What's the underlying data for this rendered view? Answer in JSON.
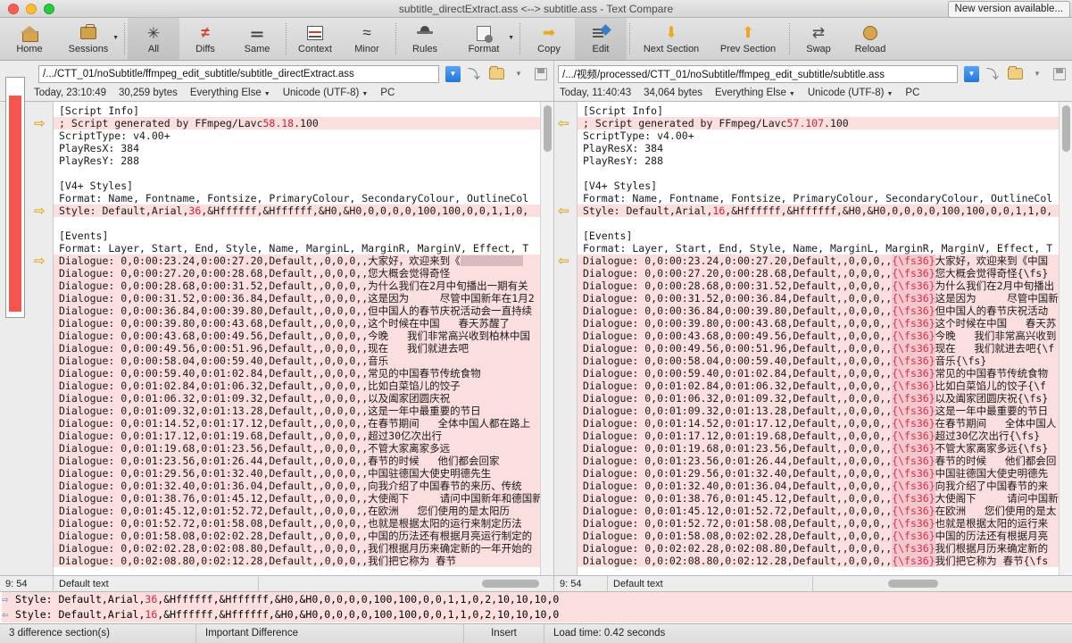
{
  "window": {
    "title": "subtitle_directExtract.ass <--> subtitle.ass - Text Compare",
    "new_version_button": "New version available..."
  },
  "toolbar": {
    "buttons": [
      {
        "label": "Home",
        "icon": "home-icon",
        "active": false,
        "dropdown": false
      },
      {
        "label": "Sessions",
        "icon": "briefcase-icon",
        "active": false,
        "dropdown": true
      },
      {
        "label": "All",
        "icon": "asterisk-icon",
        "active": true,
        "dropdown": false
      },
      {
        "label": "Diffs",
        "icon": "not-equal-icon",
        "active": false,
        "dropdown": false
      },
      {
        "label": "Same",
        "icon": "equals-icon",
        "active": false,
        "dropdown": false
      },
      {
        "label": "Context",
        "icon": "context-lines-icon",
        "active": false,
        "dropdown": false
      },
      {
        "label": "Minor",
        "icon": "approx-equal-icon",
        "active": false,
        "dropdown": false
      },
      {
        "label": "Rules",
        "icon": "rules-detective-icon",
        "active": false,
        "dropdown": false
      },
      {
        "label": "Format",
        "icon": "format-gear-icon",
        "active": false,
        "dropdown": true
      },
      {
        "label": "Copy",
        "icon": "copy-arrow-icon",
        "active": false,
        "dropdown": false
      },
      {
        "label": "Edit",
        "icon": "edit-pencil-icon",
        "active": true,
        "dropdown": false
      },
      {
        "label": "Next Section",
        "icon": "arrow-down-icon",
        "active": false,
        "dropdown": false
      },
      {
        "label": "Prev Section",
        "icon": "arrow-up-icon",
        "active": false,
        "dropdown": false
      },
      {
        "label": "Swap",
        "icon": "swap-icon",
        "active": false,
        "dropdown": false
      },
      {
        "label": "Reload",
        "icon": "reload-icon",
        "active": false,
        "dropdown": false
      }
    ]
  },
  "left_file": {
    "path": "/.../CTT_01/noSubtitle/ffmpeg_edit_subtitle/subtitle_directExtract.ass",
    "timestamp": "Today, 23:10:49",
    "size": "30,259 bytes",
    "ruleset": "Everything Else",
    "encoding": "Unicode (UTF-8)",
    "line_endings": "PC",
    "cursor": "9: 54",
    "style_info": "Default text"
  },
  "right_file": {
    "path": "/.../视频/processed/CTT_01/noSubtitle/ffmpeg_edit_subtitle/subtitle.ass",
    "timestamp": "Today, 11:40:43",
    "size": "34,064 bytes",
    "ruleset": "Everything Else",
    "encoding": "Unicode (UTF-8)",
    "line_endings": "PC",
    "cursor": "9: 54",
    "style_info": "Default text"
  },
  "left_lines": [
    {
      "text": "[Script Info]",
      "diff": false,
      "marker": false
    },
    {
      "text": "; Script generated by FFmpeg/Lavc58.18.100",
      "diff": true,
      "marker": true,
      "hl": "58.18"
    },
    {
      "text": "ScriptType: v4.00+",
      "diff": false,
      "marker": false
    },
    {
      "text": "PlayResX: 384",
      "diff": false,
      "marker": false
    },
    {
      "text": "PlayResY: 288",
      "diff": false,
      "marker": false
    },
    {
      "text": "",
      "diff": false,
      "marker": false
    },
    {
      "text": "[V4+ Styles]",
      "diff": false,
      "marker": false
    },
    {
      "text": "Format: Name, Fontname, Fontsize, PrimaryColour, SecondaryColour, OutlineCol",
      "diff": false,
      "marker": false
    },
    {
      "text": "Style: Default,Arial,36,&Hffffff,&Hffffff,&H0,&H0,0,0,0,0,100,100,0,0,1,1,0,",
      "diff": true,
      "marker": true,
      "hl": "36"
    },
    {
      "text": "",
      "diff": false,
      "marker": false
    },
    {
      "text": "[Events]",
      "diff": false,
      "marker": false
    },
    {
      "text": "Format: Layer, Start, End, Style, Name, MarginL, MarginR, MarginV, Effect, T",
      "diff": false,
      "marker": false
    },
    {
      "text": "Dialogue: 0,0:00:23.24,0:00:27.20,Default,,0,0,0,,大家好，欢迎来到《",
      "diff": true,
      "marker": true,
      "redact": true
    },
    {
      "text": "Dialogue: 0,0:00:27.20,0:00:28.68,Default,,0,0,0,,您大概会觉得奇怪",
      "diff": true,
      "marker": false
    },
    {
      "text": "Dialogue: 0,0:00:28.68,0:00:31.52,Default,,0,0,0,,为什么我们在2月中旬播出一期有关",
      "diff": true,
      "marker": false
    },
    {
      "text": "Dialogue: 0,0:00:31.52,0:00:36.84,Default,,0,0,0,,这是因为     尽管中国新年在1月2",
      "diff": true,
      "marker": false
    },
    {
      "text": "Dialogue: 0,0:00:36.84,0:00:39.80,Default,,0,0,0,,但中国人的春节庆祝活动会一直持续",
      "diff": true,
      "marker": false
    },
    {
      "text": "Dialogue: 0,0:00:39.80,0:00:43.68,Default,,0,0,0,,这个时候在中国   春天苏醒了",
      "diff": true,
      "marker": false
    },
    {
      "text": "Dialogue: 0,0:00:43.68,0:00:49.56,Default,,0,0,0,,今晚   我们非常高兴收到柏林中国",
      "diff": true,
      "marker": false
    },
    {
      "text": "Dialogue: 0,0:00:49.56,0:00:51.96,Default,,0,0,0,,现在   我们就进去吧",
      "diff": true,
      "marker": false
    },
    {
      "text": "Dialogue: 0,0:00:58.04,0:00:59.40,Default,,0,0,0,,音乐",
      "diff": true,
      "marker": false
    },
    {
      "text": "Dialogue: 0,0:00:59.40,0:01:02.84,Default,,0,0,0,,常见的中国春节传统食物",
      "diff": true,
      "marker": false
    },
    {
      "text": "Dialogue: 0,0:01:02.84,0:01:06.32,Default,,0,0,0,,比如白菜馅儿的饺子",
      "diff": true,
      "marker": false
    },
    {
      "text": "Dialogue: 0,0:01:06.32,0:01:09.32,Default,,0,0,0,,以及阖家团圆庆祝",
      "diff": true,
      "marker": false
    },
    {
      "text": "Dialogue: 0,0:01:09.32,0:01:13.28,Default,,0,0,0,,这是一年中最重要的节日",
      "diff": true,
      "marker": false
    },
    {
      "text": "Dialogue: 0,0:01:14.52,0:01:17.12,Default,,0,0,0,,在春节期间   全体中国人都在路上",
      "diff": true,
      "marker": false
    },
    {
      "text": "Dialogue: 0,0:01:17.12,0:01:19.68,Default,,0,0,0,,超过30亿次出行",
      "diff": true,
      "marker": false
    },
    {
      "text": "Dialogue: 0,0:01:19.68,0:01:23.56,Default,,0,0,0,,不管大家离家多远",
      "diff": true,
      "marker": false
    },
    {
      "text": "Dialogue: 0,0:01:23.56,0:01:26.44,Default,,0,0,0,,春节的时候   他们都会回家",
      "diff": true,
      "marker": false
    },
    {
      "text": "Dialogue: 0,0:01:29.56,0:01:32.40,Default,,0,0,0,,中国驻德国大使史明德先生",
      "diff": true,
      "marker": false
    },
    {
      "text": "Dialogue: 0,0:01:32.40,0:01:36.04,Default,,0,0,0,,向我介绍了中国春节的来历、传统",
      "diff": true,
      "marker": false
    },
    {
      "text": "Dialogue: 0,0:01:38.76,0:01:45.12,Default,,0,0,0,,大使阁下     请问中国新年和德国新",
      "diff": true,
      "marker": false
    },
    {
      "text": "Dialogue: 0,0:01:45.12,0:01:52.72,Default,,0,0,0,,在欧洲   您们使用的是太阳历",
      "diff": true,
      "marker": false
    },
    {
      "text": "Dialogue: 0,0:01:52.72,0:01:58.08,Default,,0,0,0,,也就是根据太阳的运行来制定历法",
      "diff": true,
      "marker": false
    },
    {
      "text": "Dialogue: 0,0:01:58.08,0:02:02.28,Default,,0,0,0,,中国的历法还有根据月亮运行制定的",
      "diff": true,
      "marker": false
    },
    {
      "text": "Dialogue: 0,0:02:02.28,0:02:08.80,Default,,0,0,0,,我们根据月历来确定新的一年开始的",
      "diff": true,
      "marker": false
    },
    {
      "text": "Dialogue: 0,0:02:08.80,0:02:12.28,Default,,0,0,0,,我们把它称为 春节",
      "diff": true,
      "marker": false
    }
  ],
  "right_lines": [
    {
      "text": "[Script Info]",
      "diff": false,
      "marker": false
    },
    {
      "text": "; Script generated by FFmpeg/Lavc57.107.100",
      "diff": true,
      "marker": true,
      "hl": "57.107"
    },
    {
      "text": "ScriptType: v4.00+",
      "diff": false,
      "marker": false
    },
    {
      "text": "PlayResX: 384",
      "diff": false,
      "marker": false
    },
    {
      "text": "PlayResY: 288",
      "diff": false,
      "marker": false
    },
    {
      "text": "",
      "diff": false,
      "marker": false
    },
    {
      "text": "[V4+ Styles]",
      "diff": false,
      "marker": false
    },
    {
      "text": "Format: Name, Fontname, Fontsize, PrimaryColour, SecondaryColour, OutlineCol",
      "diff": false,
      "marker": false
    },
    {
      "text": "Style: Default,Arial,16,&Hffffff,&Hffffff,&H0,&H0,0,0,0,0,100,100,0,0,1,1,0,",
      "diff": true,
      "marker": true,
      "hl": "16"
    },
    {
      "text": "",
      "diff": false,
      "marker": false
    },
    {
      "text": "[Events]",
      "diff": false,
      "marker": false
    },
    {
      "text": "Format: Layer, Start, End, Style, Name, MarginL, MarginR, MarginV, Effect, T",
      "diff": false,
      "marker": false
    },
    {
      "text": "Dialogue: 0,0:00:23.24,0:00:27.20,Default,,0,0,0,,",
      "tag": "{\\fs36}",
      "tail": "大家好，欢迎来到《中国",
      "diff": true,
      "marker": true
    },
    {
      "text": "Dialogue: 0,0:00:27.20,0:00:28.68,Default,,0,0,0,,",
      "tag": "{\\fs36}",
      "tail": "您大概会觉得奇怪{\\fs}",
      "diff": true,
      "marker": false
    },
    {
      "text": "Dialogue: 0,0:00:28.68,0:00:31.52,Default,,0,0,0,,",
      "tag": "{\\fs36}",
      "tail": "为什么我们在2月中旬播出",
      "diff": true,
      "marker": false
    },
    {
      "text": "Dialogue: 0,0:00:31.52,0:00:36.84,Default,,0,0,0,,",
      "tag": "{\\fs36}",
      "tail": "这是因为     尽管中国新",
      "diff": true,
      "marker": false
    },
    {
      "text": "Dialogue: 0,0:00:36.84,0:00:39.80,Default,,0,0,0,,",
      "tag": "{\\fs36}",
      "tail": "但中国人的春节庆祝活动",
      "diff": true,
      "marker": false
    },
    {
      "text": "Dialogue: 0,0:00:39.80,0:00:43.68,Default,,0,0,0,,",
      "tag": "{\\fs36}",
      "tail": "这个时候在中国   春天苏",
      "diff": true,
      "marker": false
    },
    {
      "text": "Dialogue: 0,0:00:43.68,0:00:49.56,Default,,0,0,0,,",
      "tag": "{\\fs36}",
      "tail": "今晚   我们非常高兴收到",
      "diff": true,
      "marker": false
    },
    {
      "text": "Dialogue: 0,0:00:49.56,0:00:51.96,Default,,0,0,0,,",
      "tag": "{\\fs36}",
      "tail": "现在   我们就进去吧{\\f",
      "diff": true,
      "marker": false
    },
    {
      "text": "Dialogue: 0,0:00:58.04,0:00:59.40,Default,,0,0,0,,",
      "tag": "{\\fs36}",
      "tail": "音乐{\\fs}",
      "diff": true,
      "marker": false
    },
    {
      "text": "Dialogue: 0,0:00:59.40,0:01:02.84,Default,,0,0,0,,",
      "tag": "{\\fs36}",
      "tail": "常见的中国春节传统食物",
      "diff": true,
      "marker": false
    },
    {
      "text": "Dialogue: 0,0:01:02.84,0:01:06.32,Default,,0,0,0,,",
      "tag": "{\\fs36}",
      "tail": "比如白菜馅儿的饺子{\\f",
      "diff": true,
      "marker": false
    },
    {
      "text": "Dialogue: 0,0:01:06.32,0:01:09.32,Default,,0,0,0,,",
      "tag": "{\\fs36}",
      "tail": "以及阖家团圆庆祝{\\fs}",
      "diff": true,
      "marker": false
    },
    {
      "text": "Dialogue: 0,0:01:09.32,0:01:13.28,Default,,0,0,0,,",
      "tag": "{\\fs36}",
      "tail": "这是一年中最重要的节日",
      "diff": true,
      "marker": false
    },
    {
      "text": "Dialogue: 0,0:01:14.52,0:01:17.12,Default,,0,0,0,,",
      "tag": "{\\fs36}",
      "tail": "在春节期间   全体中国人",
      "diff": true,
      "marker": false
    },
    {
      "text": "Dialogue: 0,0:01:17.12,0:01:19.68,Default,,0,0,0,,",
      "tag": "{\\fs36}",
      "tail": "超过30亿次出行{\\fs}",
      "diff": true,
      "marker": false
    },
    {
      "text": "Dialogue: 0,0:01:19.68,0:01:23.56,Default,,0,0,0,,",
      "tag": "{\\fs36}",
      "tail": "不管大家离家多远{\\fs}",
      "diff": true,
      "marker": false
    },
    {
      "text": "Dialogue: 0,0:01:23.56,0:01:26.44,Default,,0,0,0,,",
      "tag": "{\\fs36}",
      "tail": "春节的时候   他们都会回",
      "diff": true,
      "marker": false
    },
    {
      "text": "Dialogue: 0,0:01:29.56,0:01:32.40,Default,,0,0,0,,",
      "tag": "{\\fs36}",
      "tail": "中国驻德国大使史明德先",
      "diff": true,
      "marker": false
    },
    {
      "text": "Dialogue: 0,0:01:32.40,0:01:36.04,Default,,0,0,0,,",
      "tag": "{\\fs36}",
      "tail": "向我介绍了中国春节的来",
      "diff": true,
      "marker": false
    },
    {
      "text": "Dialogue: 0,0:01:38.76,0:01:45.12,Default,,0,0,0,,",
      "tag": "{\\fs36}",
      "tail": "大使阁下     请问中国新",
      "diff": true,
      "marker": false
    },
    {
      "text": "Dialogue: 0,0:01:45.12,0:01:52.72,Default,,0,0,0,,",
      "tag": "{\\fs36}",
      "tail": "在欧洲   您们使用的是太",
      "diff": true,
      "marker": false
    },
    {
      "text": "Dialogue: 0,0:01:52.72,0:01:58.08,Default,,0,0,0,,",
      "tag": "{\\fs36}",
      "tail": "也就是根据太阳的运行来",
      "diff": true,
      "marker": false
    },
    {
      "text": "Dialogue: 0,0:01:58.08,0:02:02.28,Default,,0,0,0,,",
      "tag": "{\\fs36}",
      "tail": "中国的历法还有根据月亮",
      "diff": true,
      "marker": false
    },
    {
      "text": "Dialogue: 0,0:02:02.28,0:02:08.80,Default,,0,0,0,,",
      "tag": "{\\fs36}",
      "tail": "我们根据月历来确定新的",
      "diff": true,
      "marker": false
    },
    {
      "text": "Dialogue: 0,0:02:08.80,0:02:12.28,Default,,0,0,0,,",
      "tag": "{\\fs36}",
      "tail": "我们把它称为 春节{\\fs",
      "diff": true,
      "marker": false
    }
  ],
  "detail_panel": {
    "lines": [
      {
        "arrow": "⇨",
        "pre": "Style: Default,Arial,",
        "hl": "36",
        "post": ",&Hffffff,&Hffffff,&H0,&H0,0,0,0,0,100,100,0,0,1,1,0,2,10,10,10,0"
      },
      {
        "arrow": "⇦",
        "pre": "Style: Default,Arial,",
        "hl": "16",
        "post": ",&Hffffff,&Hffffff,&H0,&H0,0,0,0,0,100,100,0,0,1,1,0,2,10,10,10,0"
      }
    ]
  },
  "status": {
    "differences": "3 difference section(s)",
    "importance": "Important Difference",
    "mode": "Insert",
    "load_time": "Load time: 0.42 seconds"
  }
}
